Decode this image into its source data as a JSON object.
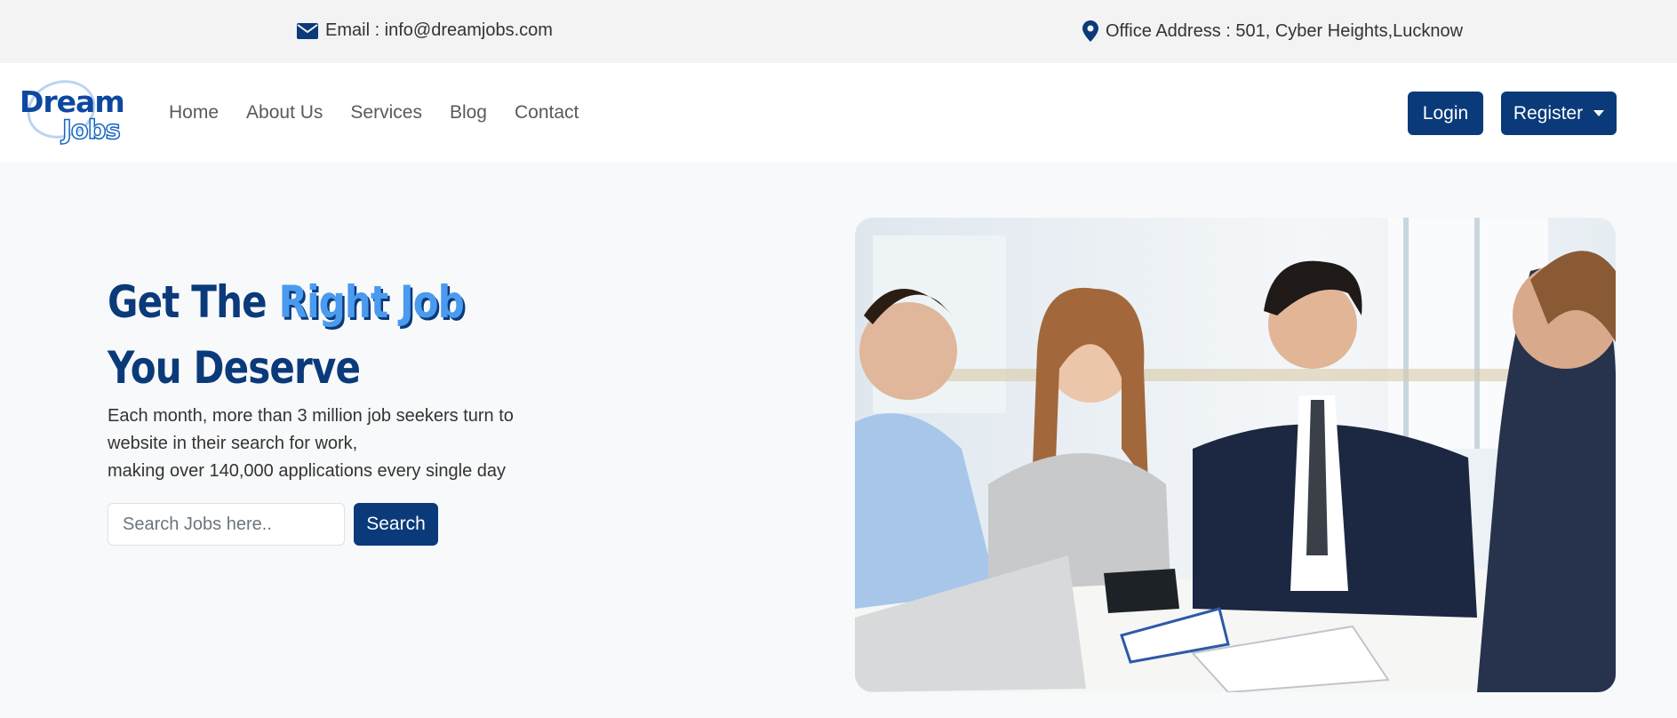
{
  "topbar": {
    "email_text": "Email : info@dreamjobs.com",
    "email_icon": "envelope-icon",
    "address_text": "Office Address : 501, Cyber Heights,Lucknow",
    "address_icon": "map-pin-icon"
  },
  "logo": {
    "line1": "Dream",
    "line2": "Jobs"
  },
  "nav": {
    "links": [
      "Home",
      "About Us",
      "Services",
      "Blog",
      "Contact"
    ],
    "login_label": "Login",
    "register_label": "Register"
  },
  "hero": {
    "headline_part1": "Get The ",
    "headline_accent": "Right Job",
    "headline_part2": "You Deserve",
    "subtext_lines": [
      "Each month, more than 3 million job seekers turn to",
      "website in their search for work,",
      "making over 140,000 applications every single day"
    ],
    "search_placeholder": "Search Jobs here..",
    "search_button": "Search"
  },
  "colors": {
    "primary": "#0a3a7a",
    "accent": "#4a9bf0",
    "topbar_bg": "#f3f3f3",
    "page_bg": "#f8f9fa"
  }
}
